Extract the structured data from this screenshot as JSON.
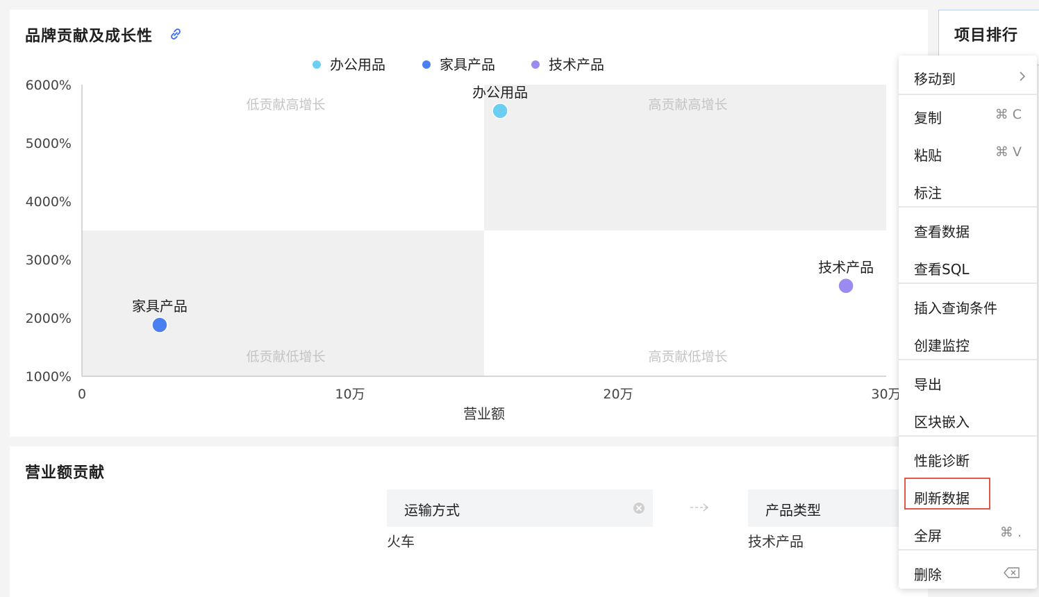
{
  "chart_panel": {
    "title": "品牌贡献及成长性"
  },
  "chart_data": {
    "type": "scatter",
    "legend": [
      "办公用品",
      "家具产品",
      "技术产品"
    ],
    "legend_placement": "top",
    "xlabel": "营业额",
    "ylabel": "",
    "x_ticks": [
      "0",
      "10万",
      "20万",
      "30万"
    ],
    "y_ticks": [
      "6000%",
      "5000%",
      "4000%",
      "3000%",
      "2000%",
      "1000%"
    ],
    "xlim": [
      0,
      300000
    ],
    "ylim": [
      1000,
      6000
    ],
    "quadrant_split": {
      "x": 150000,
      "y": 3500
    },
    "quadrants": [
      "低贡献高增长",
      "高贡献高增长",
      "低贡献低增长",
      "高贡献低增长"
    ],
    "points": [
      {
        "name": "办公用品",
        "x": 156000,
        "y": 5550,
        "color": "#6ccff2"
      },
      {
        "name": "家具产品",
        "x": 29000,
        "y": 1880,
        "color": "#4a7ff2"
      },
      {
        "name": "技术产品",
        "x": 285000,
        "y": 2550,
        "color": "#9b8bf0"
      }
    ],
    "grid": false
  },
  "right_panel": {
    "title": "项目排行"
  },
  "bottom_panel": {
    "title": "营业额贡献",
    "filters": [
      {
        "label": "运输方式",
        "value": "火车"
      },
      {
        "label": "产品类型",
        "value": "技术产品"
      }
    ]
  },
  "context_menu": {
    "items": [
      {
        "label": "移动到",
        "shortcut": ""
      },
      {
        "label": "复制",
        "shortcut": "⌘ C"
      },
      {
        "label": "粘贴",
        "shortcut": "⌘ V"
      },
      {
        "label": "标注",
        "shortcut": ""
      },
      {
        "label": "查看数据",
        "shortcut": ""
      },
      {
        "label": "查看SQL",
        "shortcut": ""
      },
      {
        "label": "插入查询条件",
        "shortcut": ""
      },
      {
        "label": "创建监控",
        "shortcut": ""
      },
      {
        "label": "导出",
        "shortcut": ""
      },
      {
        "label": "区块嵌入",
        "shortcut": ""
      },
      {
        "label": "性能诊断",
        "shortcut": ""
      },
      {
        "label": "刷新数据",
        "shortcut": ""
      },
      {
        "label": "全屏",
        "shortcut": "⌘ ."
      },
      {
        "label": "删除",
        "shortcut": ""
      }
    ],
    "highlighted": "刷新数据"
  },
  "colors": {
    "accent": "#3b6ef5",
    "highlight_border": "#e0574a",
    "quadrant_fill": "#f0f0f0"
  }
}
